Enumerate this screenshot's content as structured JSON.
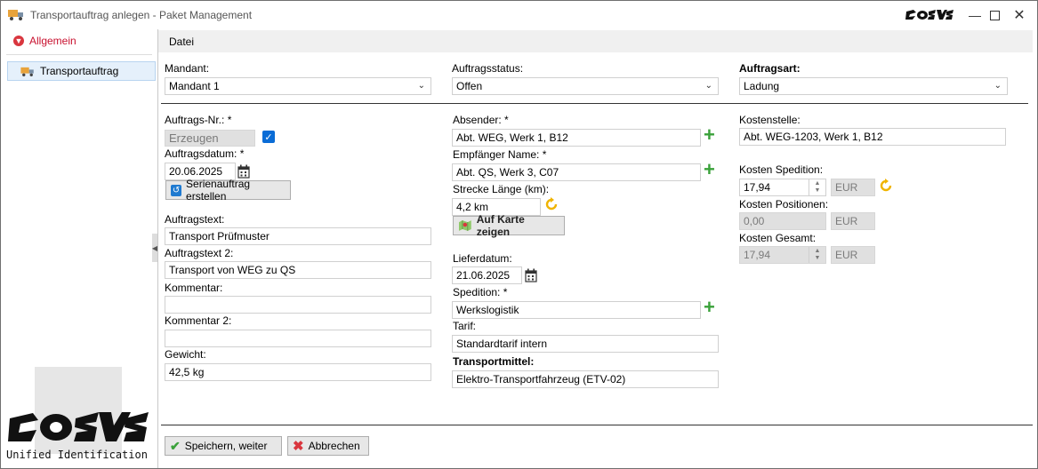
{
  "window": {
    "title": "Transportauftrag anlegen - Paket Management"
  },
  "sidebar": {
    "group_label": "Allgemein",
    "items": [
      {
        "label": "Transportauftrag"
      }
    ],
    "logo_caption": "Unified Identification"
  },
  "menu": {
    "file": "Datei"
  },
  "header_fields": {
    "mandant": {
      "label": "Mandant:",
      "value": "Mandant 1"
    },
    "auftragsstatus": {
      "label": "Auftragsstatus:",
      "value": "Offen"
    },
    "auftragsart": {
      "label": "Auftragsart:",
      "value": "Ladung"
    }
  },
  "col1": {
    "auftragsnr": {
      "label": "Auftrags-Nr.: *",
      "value": "Erzeugen",
      "generate_checked": true
    },
    "auftragsdatum": {
      "label": "Auftragsdatum: *",
      "value": "20.06.2025"
    },
    "serien_button": "Serienauftrag erstellen",
    "auftragstext": {
      "label": "Auftragstext:",
      "value": "Transport Prüfmuster"
    },
    "auftragstext2": {
      "label": "Auftragstext 2:",
      "value": "Transport von WEG zu QS"
    },
    "kommentar": {
      "label": "Kommentar:",
      "value": ""
    },
    "kommentar2": {
      "label": "Kommentar 2:",
      "value": ""
    },
    "gewicht": {
      "label": "Gewicht:",
      "value": "42,5 kg"
    }
  },
  "col2": {
    "absender": {
      "label": "Absender: *",
      "value": "Abt. WEG, Werk 1, B12"
    },
    "empfaenger": {
      "label": "Empfänger Name: *",
      "value": "Abt. QS, Werk 3, C07"
    },
    "strecke": {
      "label": "Strecke Länge (km):",
      "value": "4,2 km"
    },
    "karte_button": "Auf Karte zeigen",
    "lieferdatum": {
      "label": "Lieferdatum:",
      "value": "21.06.2025"
    },
    "spedition": {
      "label": "Spedition: *",
      "value": "Werkslogistik"
    },
    "tarif": {
      "label": "Tarif:",
      "value": "Standardtarif intern"
    },
    "transportmittel": {
      "label": "Transportmittel:",
      "value": "Elektro-Transportfahrzeug (ETV-02)"
    }
  },
  "col3": {
    "kostenstelle": {
      "label": "Kostenstelle:",
      "value": "Abt. WEG-1203, Werk 1, B12"
    },
    "kosten_spedition": {
      "label": "Kosten Spedition:",
      "value": "17,94",
      "currency": "EUR"
    },
    "kosten_positionen": {
      "label": "Kosten Positionen:",
      "value": "0,00",
      "currency": "EUR"
    },
    "kosten_gesamt": {
      "label": "Kosten Gesamt:",
      "value": "17,94",
      "currency": "EUR"
    }
  },
  "footer": {
    "save": "Speichern, weiter",
    "cancel": "Abbrechen"
  },
  "colors": {
    "accent_red": "#c8102e",
    "plus_green": "#3aa13a",
    "refresh_yellow": "#f0b400",
    "check_blue": "#0a6cd6"
  }
}
